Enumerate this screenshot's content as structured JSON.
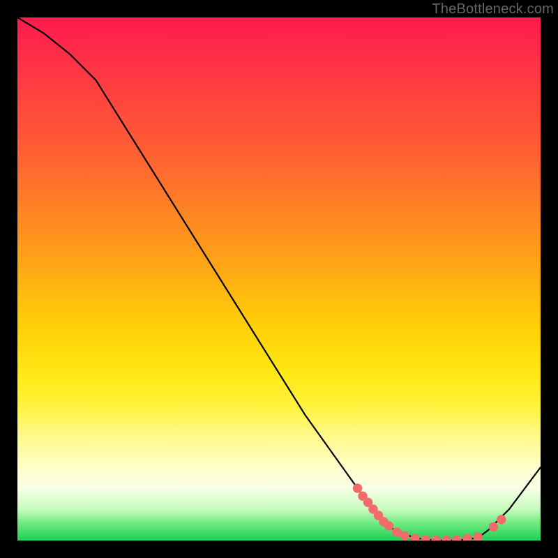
{
  "watermark": "TheBottleneck.com",
  "chart_data": {
    "type": "line",
    "title": "",
    "xlabel": "",
    "ylabel": "",
    "xlim": [
      0,
      100
    ],
    "ylim": [
      0,
      100
    ],
    "grid": false,
    "background_gradient": {
      "direction": "vertical",
      "stops": [
        {
          "pct": 0,
          "color": "#ff1a4d"
        },
        {
          "pct": 50,
          "color": "#ffb80f"
        },
        {
          "pct": 80,
          "color": "#fff98a"
        },
        {
          "pct": 95,
          "color": "#c8fbbf"
        },
        {
          "pct": 100,
          "color": "#1ecf57"
        }
      ]
    },
    "series": [
      {
        "name": "curve",
        "color": "#000000",
        "x": [
          0,
          5,
          10,
          15,
          20,
          25,
          30,
          35,
          40,
          45,
          50,
          55,
          60,
          65,
          68,
          72,
          76,
          80,
          84,
          88,
          90,
          94,
          100
        ],
        "y": [
          100,
          97,
          93,
          88,
          80,
          72,
          64,
          56,
          48,
          40,
          32,
          24,
          17,
          10,
          6,
          2,
          0.5,
          0,
          0,
          0.5,
          2,
          6,
          14
        ]
      }
    ],
    "markers": [
      {
        "name": "marker-set",
        "color": "#f26a6a",
        "points": [
          {
            "x": 65,
            "y": 10
          },
          {
            "x": 66,
            "y": 8.5
          },
          {
            "x": 67,
            "y": 7.3
          },
          {
            "x": 68,
            "y": 6.0
          },
          {
            "x": 69,
            "y": 4.8
          },
          {
            "x": 70,
            "y": 3.6
          },
          {
            "x": 71,
            "y": 2.8
          },
          {
            "x": 72.5,
            "y": 1.6
          },
          {
            "x": 74,
            "y": 0.9
          },
          {
            "x": 76,
            "y": 0.4
          },
          {
            "x": 78,
            "y": 0.15
          },
          {
            "x": 80,
            "y": 0.05
          },
          {
            "x": 82,
            "y": 0.05
          },
          {
            "x": 84,
            "y": 0.15
          },
          {
            "x": 86,
            "y": 0.4
          },
          {
            "x": 88,
            "y": 0.7
          },
          {
            "x": 91,
            "y": 2.6
          },
          {
            "x": 92.5,
            "y": 4.0
          }
        ]
      }
    ]
  }
}
